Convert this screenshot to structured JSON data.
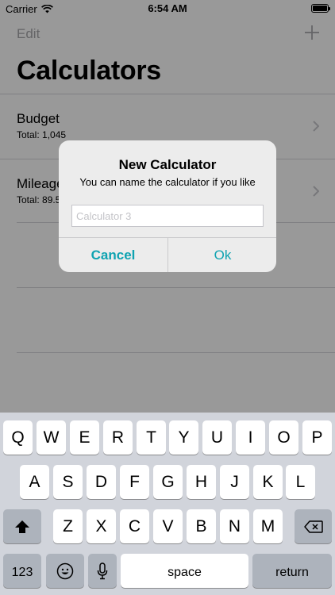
{
  "status_bar": {
    "carrier": "Carrier",
    "time": "6:54 AM",
    "battery_level": 1.0
  },
  "nav": {
    "edit_label": "Edit",
    "add_icon": "plus-icon"
  },
  "page": {
    "title": "Calculators"
  },
  "list": {
    "items": [
      {
        "title": "Budget",
        "subtitle": "Total: 1,045"
      },
      {
        "title": "Mileage",
        "subtitle": "Total: 89.5"
      }
    ]
  },
  "alert": {
    "title": "New Calculator",
    "message": "You can name the calculator if you like",
    "input_value": "",
    "input_placeholder": "Calculator 3",
    "cancel_label": "Cancel",
    "ok_label": "Ok"
  },
  "keyboard": {
    "row1": [
      "Q",
      "W",
      "E",
      "R",
      "T",
      "Y",
      "U",
      "I",
      "O",
      "P"
    ],
    "row2": [
      "A",
      "S",
      "D",
      "F",
      "G",
      "H",
      "J",
      "K",
      "L"
    ],
    "row3": [
      "Z",
      "X",
      "C",
      "V",
      "B",
      "N",
      "M"
    ],
    "numbers_label": "123",
    "space_label": "space",
    "return_label": "return"
  },
  "colors": {
    "accent": "#0fa3b1",
    "muted": "#a7a7ab"
  }
}
